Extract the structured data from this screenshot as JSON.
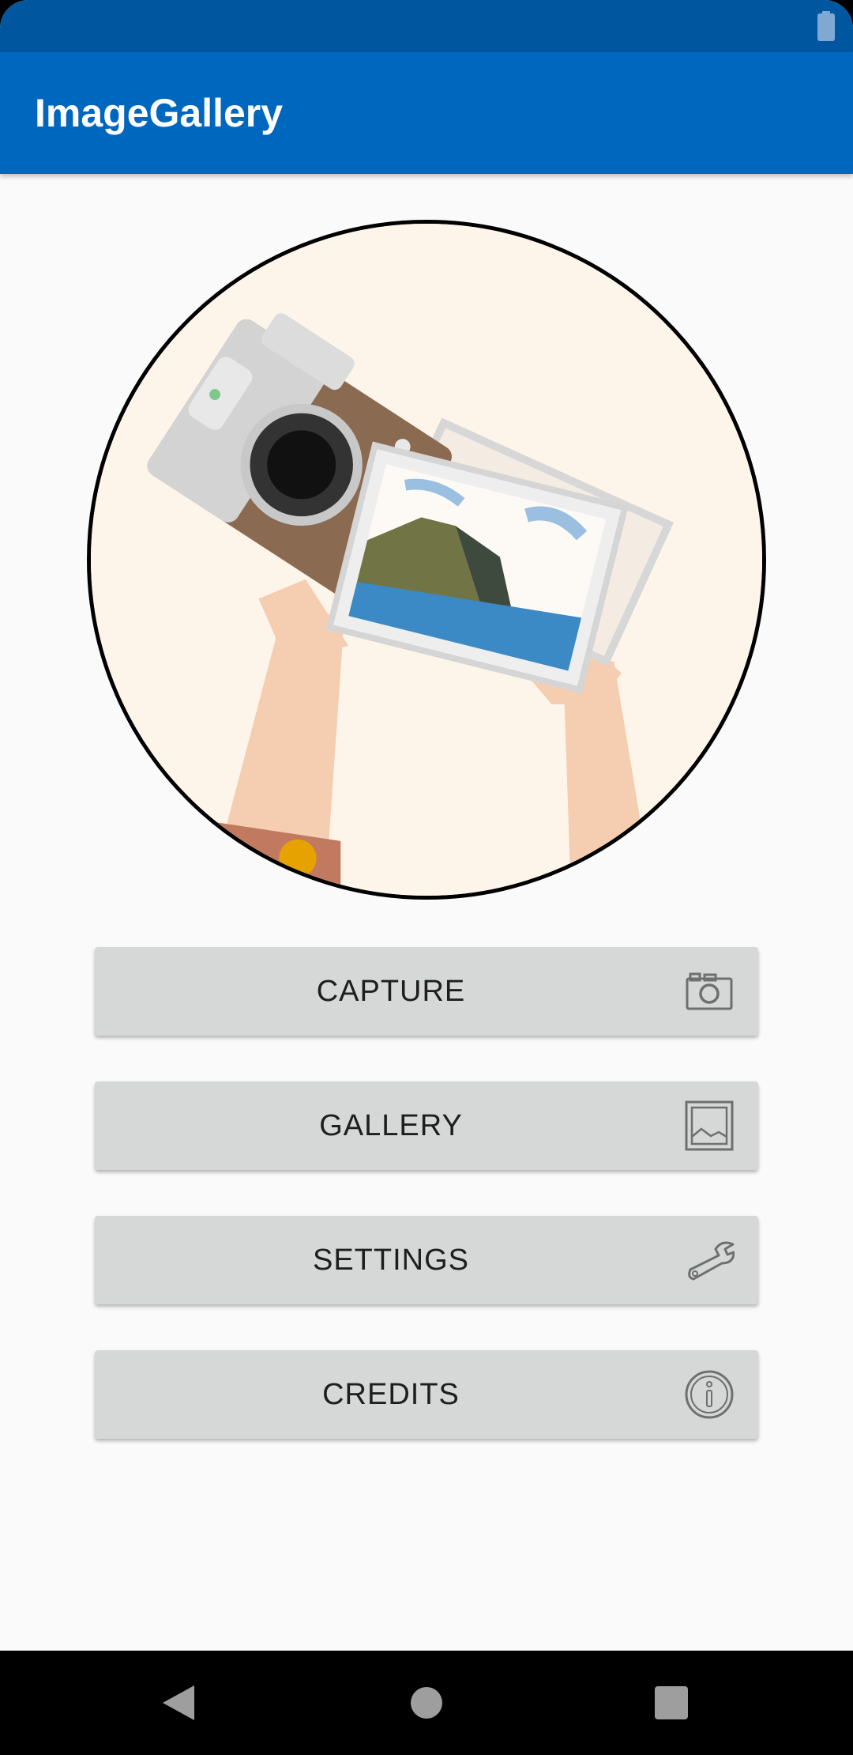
{
  "app": {
    "title": "ImageGallery"
  },
  "status_bar": {
    "icons": [
      "battery-icon"
    ]
  },
  "hero": {
    "icon": "camera-and-photos-illustration"
  },
  "menu": [
    {
      "label": "CAPTURE",
      "icon": "camera-icon"
    },
    {
      "label": "GALLERY",
      "icon": "image-icon"
    },
    {
      "label": "SETTINGS",
      "icon": "wrench-icon"
    },
    {
      "label": "CREDITS",
      "icon": "info-icon"
    }
  ],
  "nav_bar": {
    "icons": [
      "back-icon",
      "home-icon",
      "recents-icon"
    ]
  },
  "colors": {
    "status_bar": "#00579f",
    "app_bar": "#0067bf",
    "background": "#fafafa",
    "button": "#d6d7d7",
    "button_text": "#1e1e1e",
    "hero_background": "#fef5ea"
  }
}
